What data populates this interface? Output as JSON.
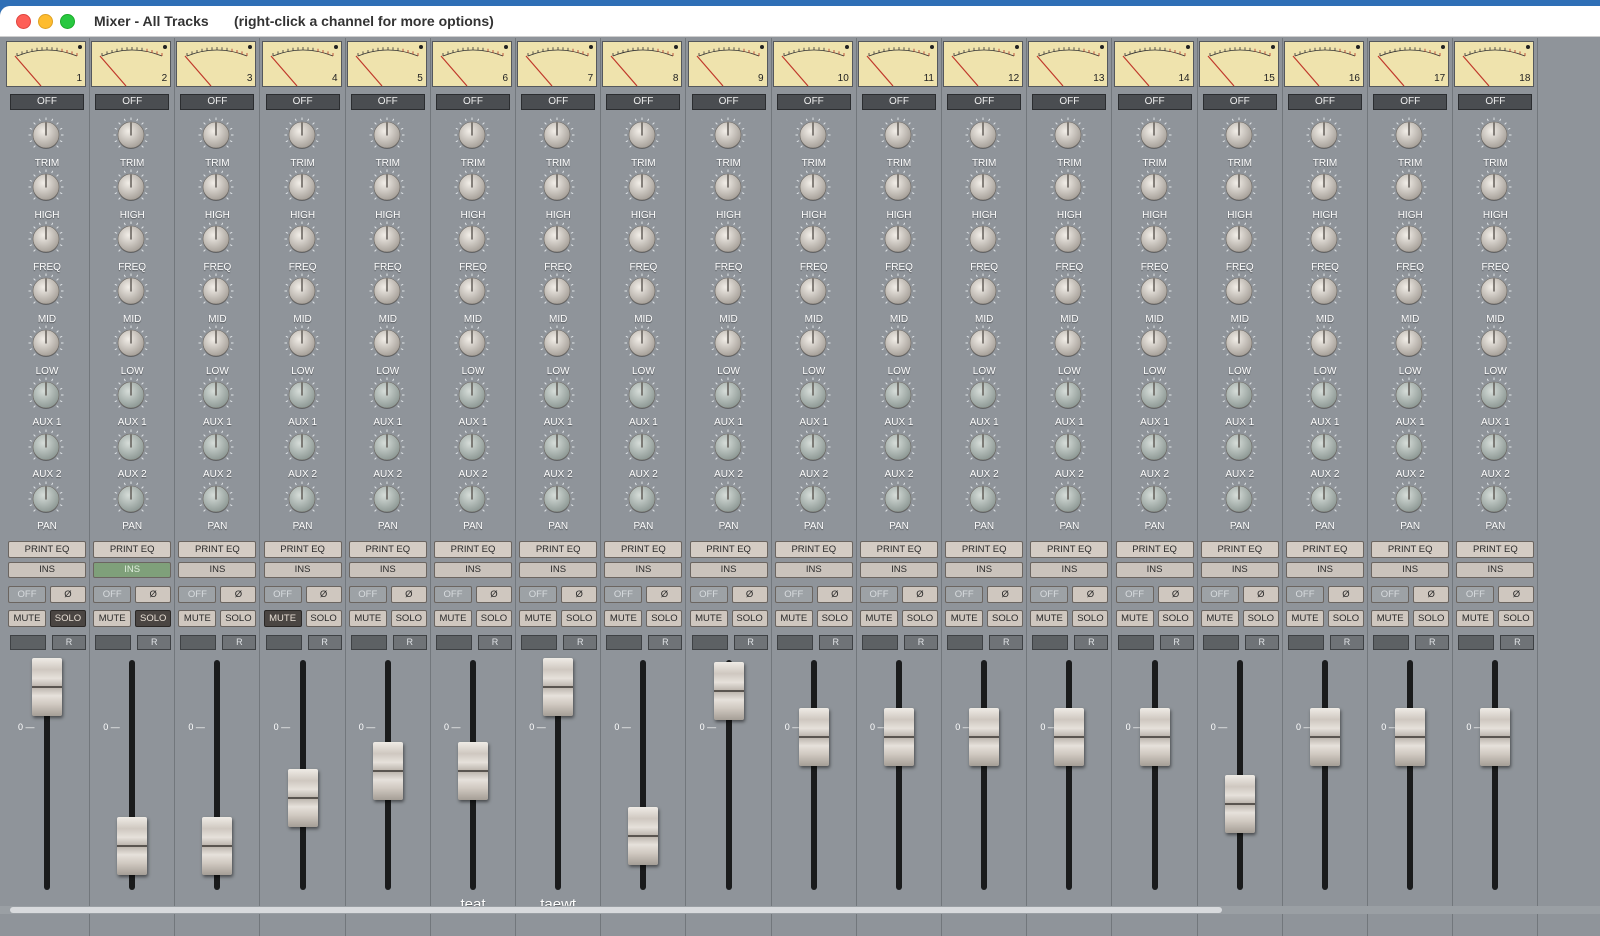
{
  "window": {
    "title": "Mixer - All Tracks",
    "subtitle": "(right-click a channel for more options)"
  },
  "labels": {
    "off": "OFF",
    "knobs": [
      "TRIM",
      "HIGH",
      "FREQ",
      "MID",
      "LOW",
      "AUX 1",
      "AUX 2",
      "PAN"
    ],
    "print_eq": "PRINT EQ",
    "ins": "INS",
    "small_off": "OFF",
    "phase": "Ø",
    "mute": "MUTE",
    "solo": "SOLO",
    "record": "R",
    "zero_mark": "0 —"
  },
  "colors": {
    "vu_face": "#efe3ad",
    "needle": "#c0392b",
    "ins_active": "#7fa07a",
    "strip_bg": "#8f949a"
  },
  "channels": [
    {
      "number": "1",
      "name": "",
      "fader": 0.96,
      "ins_active": false,
      "mute": false,
      "solo": true
    },
    {
      "number": "2",
      "name": "",
      "fader": 0.13,
      "ins_active": true,
      "mute": false,
      "solo": true
    },
    {
      "number": "3",
      "name": "",
      "fader": 0.13,
      "ins_active": false,
      "mute": false,
      "solo": false
    },
    {
      "number": "4",
      "name": "",
      "fader": 0.38,
      "ins_active": false,
      "mute": true,
      "solo": false
    },
    {
      "number": "5",
      "name": "",
      "fader": 0.52,
      "ins_active": false,
      "mute": false,
      "solo": false
    },
    {
      "number": "6",
      "name": "teat",
      "fader": 0.52,
      "ins_active": false,
      "mute": false,
      "solo": false
    },
    {
      "number": "7",
      "name": "taewt",
      "fader": 0.96,
      "ins_active": false,
      "mute": false,
      "solo": false
    },
    {
      "number": "8",
      "name": "",
      "fader": 0.18,
      "ins_active": false,
      "mute": false,
      "solo": false
    },
    {
      "number": "9",
      "name": "",
      "fader": 0.94,
      "ins_active": false,
      "mute": false,
      "solo": false
    },
    {
      "number": "10",
      "name": "",
      "fader": 0.7,
      "ins_active": false,
      "mute": false,
      "solo": false
    },
    {
      "number": "11",
      "name": "",
      "fader": 0.7,
      "ins_active": false,
      "mute": false,
      "solo": false
    },
    {
      "number": "12",
      "name": "",
      "fader": 0.7,
      "ins_active": false,
      "mute": false,
      "solo": false
    },
    {
      "number": "13",
      "name": "",
      "fader": 0.7,
      "ins_active": false,
      "mute": false,
      "solo": false
    },
    {
      "number": "14",
      "name": "",
      "fader": 0.7,
      "ins_active": false,
      "mute": false,
      "solo": false
    },
    {
      "number": "15",
      "name": "",
      "fader": 0.35,
      "ins_active": false,
      "mute": false,
      "solo": false
    },
    {
      "number": "16",
      "name": "",
      "fader": 0.7,
      "ins_active": false,
      "mute": false,
      "solo": false
    },
    {
      "number": "17",
      "name": "",
      "fader": 0.7,
      "ins_active": false,
      "mute": false,
      "solo": false
    },
    {
      "number": "18",
      "name": "",
      "fader": 0.7,
      "ins_active": false,
      "mute": false,
      "solo": false
    }
  ]
}
